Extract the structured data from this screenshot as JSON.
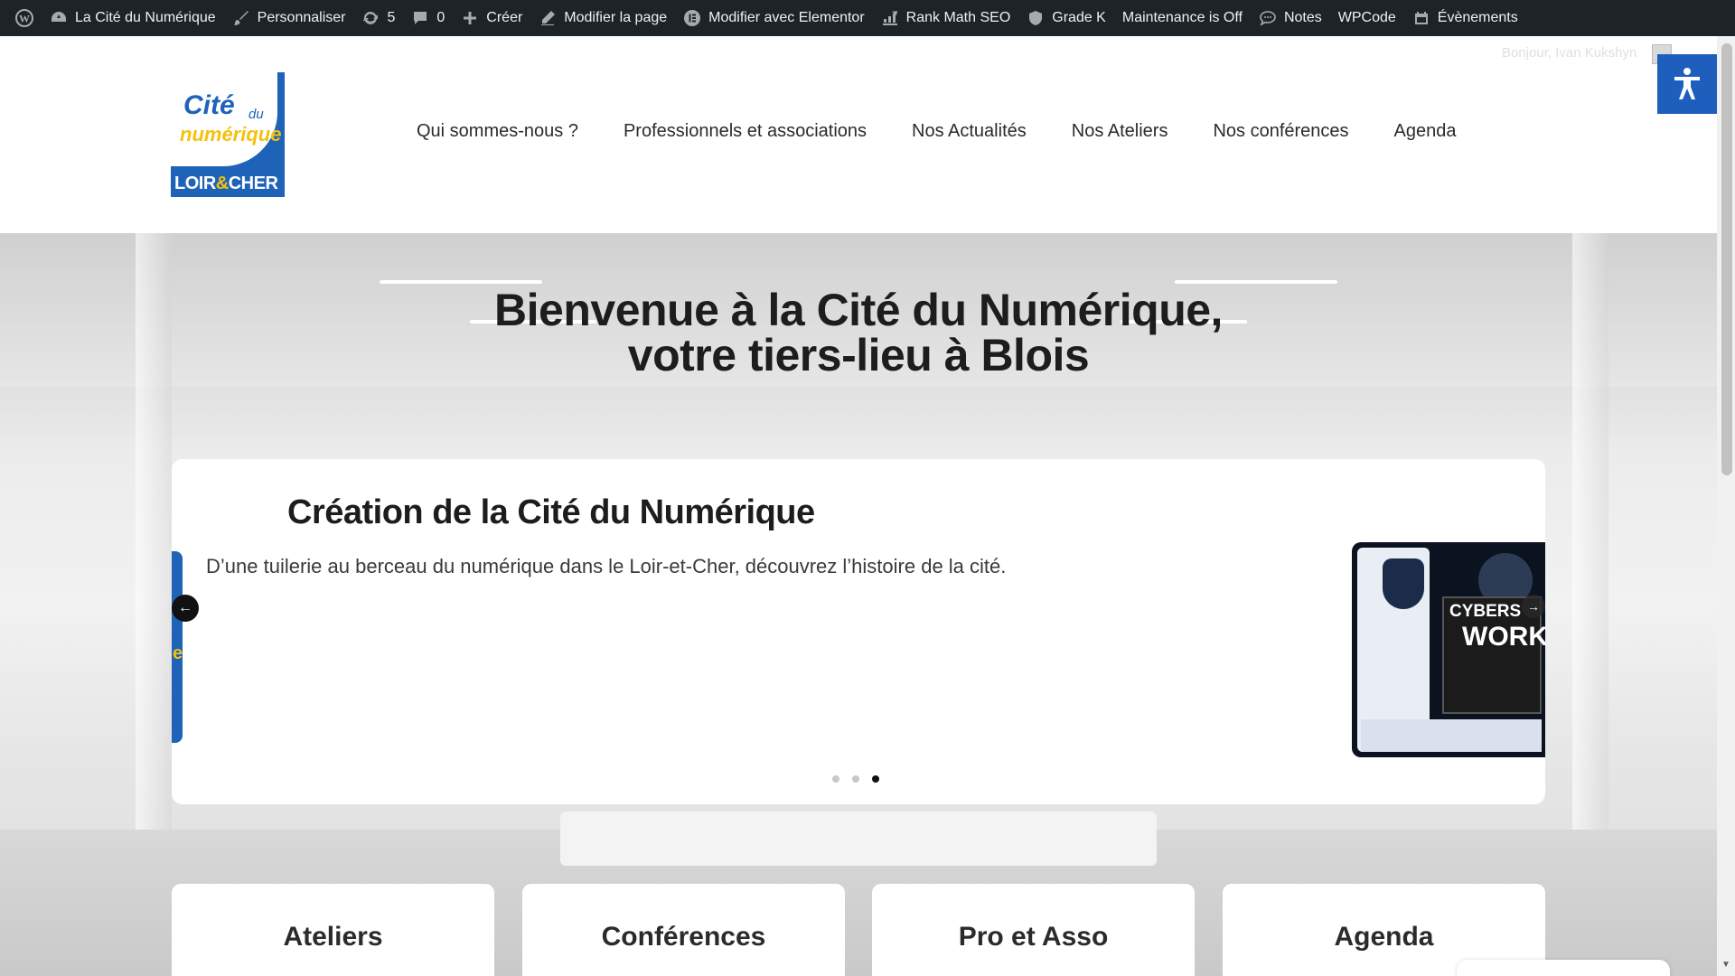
{
  "adminbar": {
    "site_name": "La Cité du Numérique",
    "customize": "Personnaliser",
    "updates_count": "5",
    "comments_count": "0",
    "create": "Créer",
    "edit_page": "Modifier la page",
    "edit_elementor": "Modifier avec Elementor",
    "rank_math": "Rank Math SEO",
    "grade": "Grade K",
    "maintenance": "Maintenance is Off",
    "notes": "Notes",
    "wpcode": "WPCode",
    "events": "Évènements"
  },
  "header": {
    "greeting": "Bonjour, Ivan Kukshyn",
    "logo": {
      "line1": "Cité",
      "line1_small": "du",
      "line2": "numérique",
      "line3a": "LOIR",
      "line3b": "&",
      "line3c": "CHER"
    },
    "nav": [
      "Qui sommes-nous ?",
      "Professionnels et associations",
      "Nos Actualités",
      "Nos Ateliers",
      "Nos conférences",
      "Agenda"
    ]
  },
  "hero": {
    "title_line1": "Bienvenue à la Cité du Numérique,",
    "title_line2": "votre tiers-lieu à Blois"
  },
  "slider": {
    "title": "Création de la Cité du Numérique",
    "description": "D’une tuilerie au berceau du numérique dans le Loir-et-Cher, découvrez l’histoire de la cité.",
    "peek_letter": "e",
    "image_text_1": "CYBERS",
    "image_text_2": "WORKS",
    "dots_total": 3,
    "active_dot": 3
  },
  "tiles": [
    "Ateliers",
    "Conférences",
    "Pro et Asso",
    "Agenda"
  ],
  "colors": {
    "admin_bg": "#1d2327",
    "brand_blue": "#1f63b8",
    "brand_yellow": "#f4c20d",
    "a11y_blue": "#1e5fbd"
  }
}
